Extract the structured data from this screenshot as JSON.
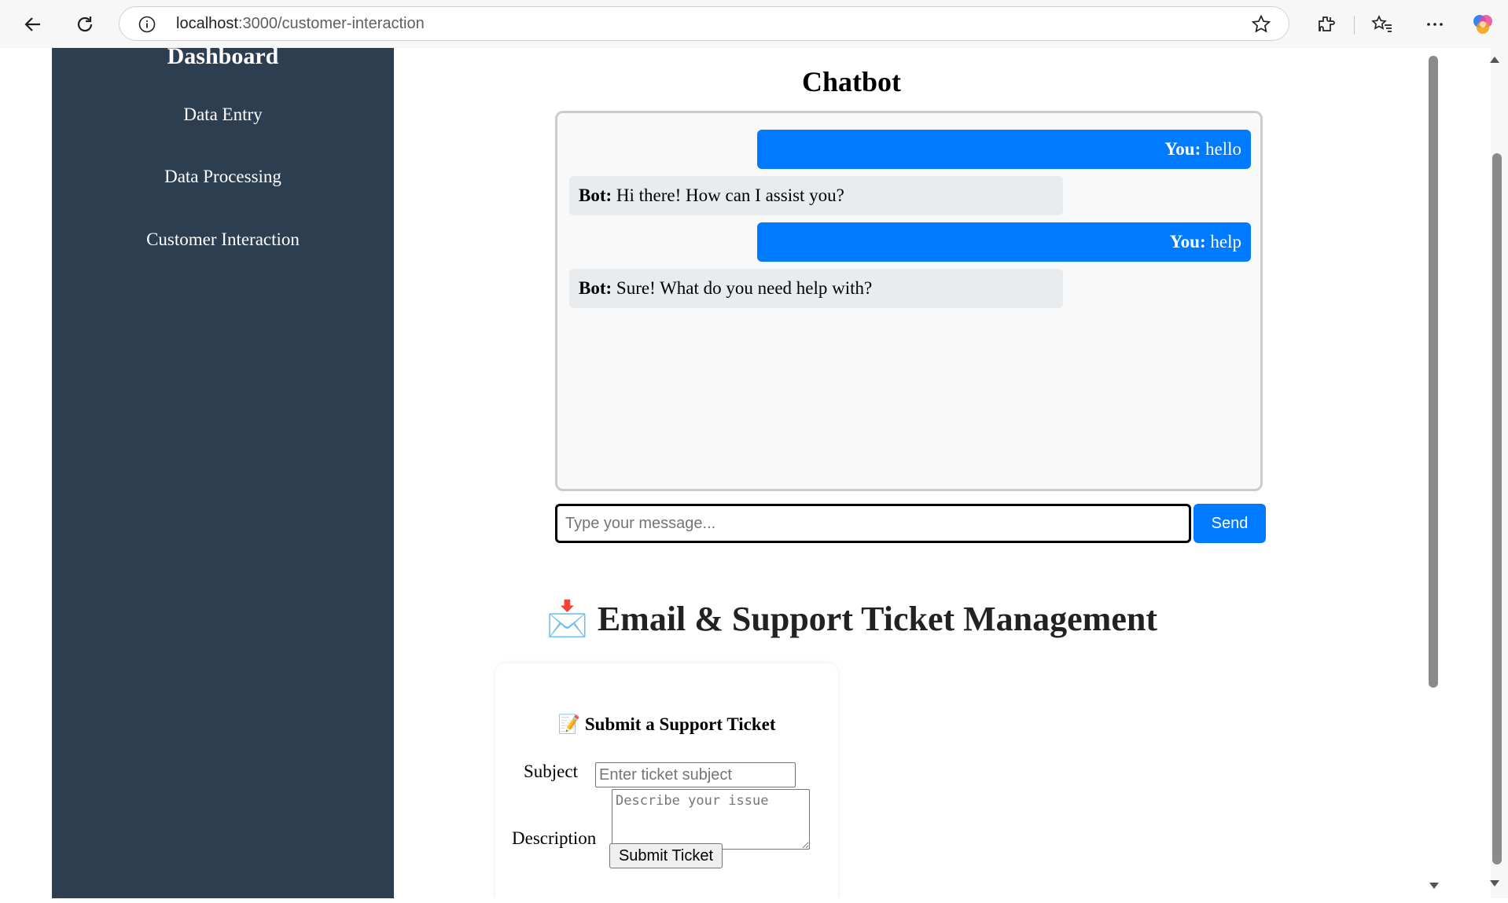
{
  "browser": {
    "url_host": "localhost",
    "url_path": ":3000/customer-interaction"
  },
  "sidebar": {
    "title": "Dashboard",
    "items": [
      {
        "label": "Data Entry"
      },
      {
        "label": "Data Processing"
      },
      {
        "label": "Customer Interaction"
      }
    ]
  },
  "chatbot": {
    "title": "Chatbot",
    "messages": [
      {
        "sender": "You:",
        "text": " hello"
      },
      {
        "sender": "Bot:",
        "text": " Hi there! How can I assist you?"
      },
      {
        "sender": "You:",
        "text": " help"
      },
      {
        "sender": "Bot:",
        "text": " Sure! What do you need help with?"
      }
    ],
    "input_placeholder": "Type your message...",
    "send_label": "Send"
  },
  "tickets": {
    "section_emoji": "📩",
    "section_title": "Email & Support Ticket Management",
    "form_emoji": "📝",
    "form_title": "Submit a Support Ticket",
    "subject_label": "Subject",
    "subject_placeholder": "Enter ticket subject",
    "description_label": "Description",
    "description_placeholder": "Describe your issue",
    "submit_label": "Submit Ticket"
  },
  "colors": {
    "sidebar_bg": "#2c3e50",
    "user_bubble": "#007bff",
    "bot_bubble": "#e9ecef",
    "send_button": "#007bff"
  }
}
